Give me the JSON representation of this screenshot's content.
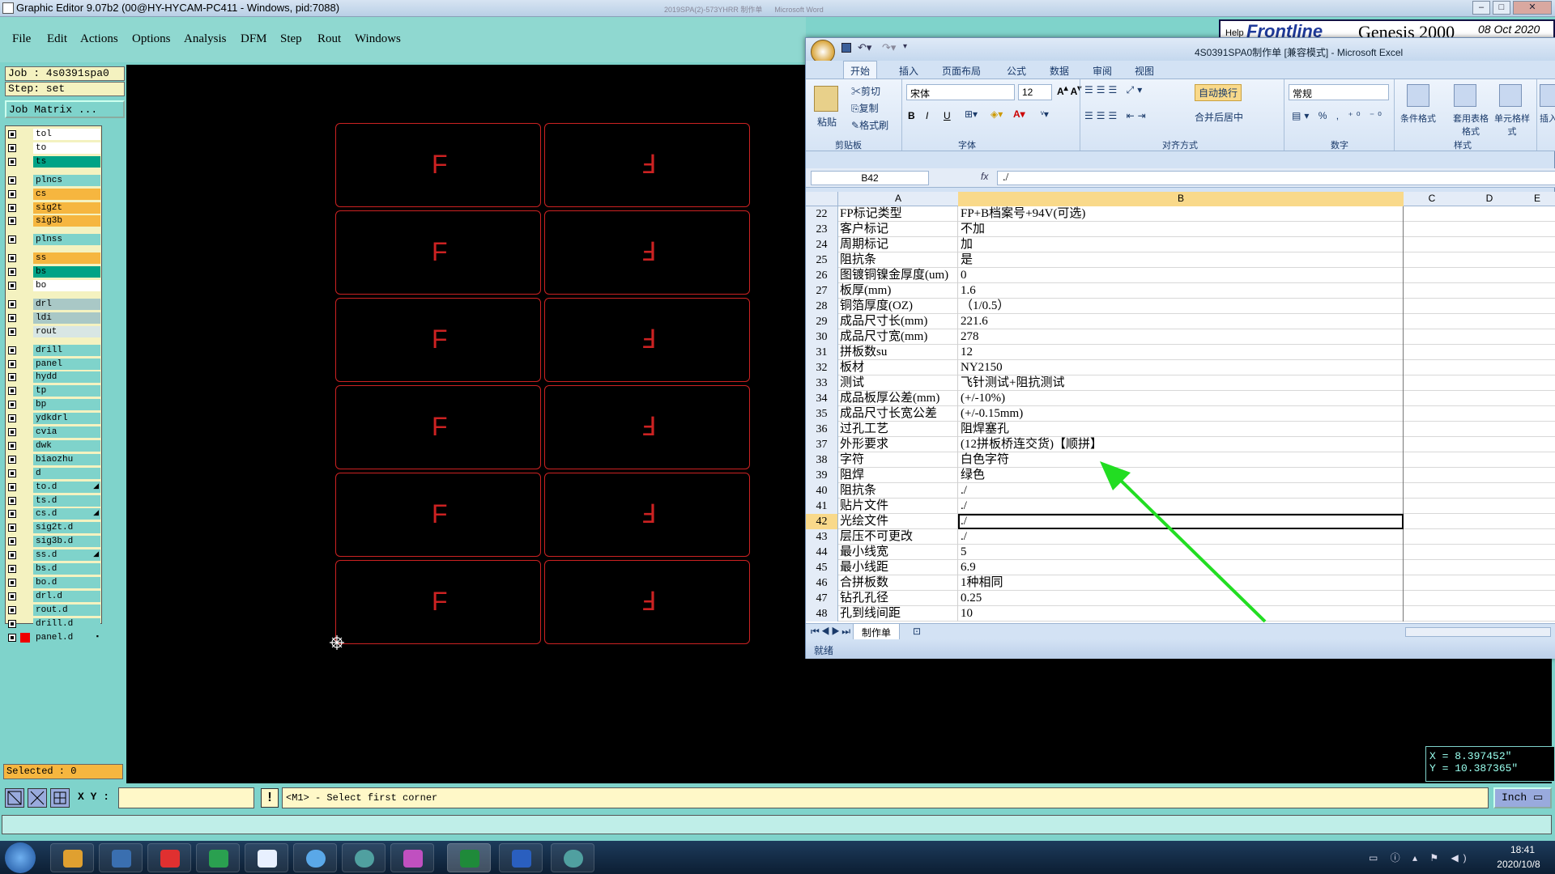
{
  "window": {
    "title": "Graphic Editor 9.07b2 (00@HY-HYCAM-PC411 - Windows, pid:7088)"
  },
  "background_window": {
    "text1": "2019SPA(2)-573YHRR 制作单",
    "text2": "Microsoft Word"
  },
  "genesis_brand": {
    "logo": "Frontline",
    "product": "Genesis 2000",
    "date": "08 Oct 2020",
    "help": "Help"
  },
  "menu": [
    "File",
    "Edit",
    "Actions",
    "Options",
    "Analysis",
    "DFM",
    "Step",
    "Rout",
    "Windows"
  ],
  "job": {
    "job_label": "Job : 4s0391spa0",
    "step_label": "Step: set",
    "matrix_button": "Job Matrix ..."
  },
  "layers": [
    {
      "name": "tol",
      "color": "#ffffff",
      "mark": ""
    },
    {
      "name": "to",
      "color": "#ffffff",
      "mark": ""
    },
    {
      "name": "ts",
      "color": "#00a386",
      "mark": ""
    },
    {
      "name": "plncs",
      "color": "#7fd3cb",
      "mark": ""
    },
    {
      "name": "cs",
      "color": "#f6b63f",
      "mark": ""
    },
    {
      "name": "sig2t",
      "color": "#f6b63f",
      "mark": ""
    },
    {
      "name": "sig3b",
      "color": "#f6b63f",
      "mark": ""
    },
    {
      "name": "plnss",
      "color": "#7fd3cb",
      "mark": ""
    },
    {
      "name": "ss",
      "color": "#f6b63f",
      "mark": ""
    },
    {
      "name": "bs",
      "color": "#00a386",
      "mark": ""
    },
    {
      "name": "bo",
      "color": "#ffffff",
      "mark": ""
    },
    {
      "name": "drl",
      "color": "#a9c8c6",
      "mark": ""
    },
    {
      "name": "ldi",
      "color": "#a9c8c6",
      "mark": ""
    },
    {
      "name": "rout",
      "color": "#d8e6e4",
      "mark": ""
    },
    {
      "name": "drill",
      "color": "#7fd3cb",
      "mark": ""
    },
    {
      "name": "panel",
      "color": "#7fd3cb",
      "mark": ""
    },
    {
      "name": "hydd",
      "color": "#7fd3cb",
      "mark": ""
    },
    {
      "name": "tp",
      "color": "#7fd3cb",
      "mark": ""
    },
    {
      "name": "bp",
      "color": "#7fd3cb",
      "mark": ""
    },
    {
      "name": "ydkdrl",
      "color": "#7fd3cb",
      "mark": ""
    },
    {
      "name": "cvia",
      "color": "#7fd3cb",
      "mark": ""
    },
    {
      "name": "dwk",
      "color": "#7fd3cb",
      "mark": ""
    },
    {
      "name": "biaozhu",
      "color": "#7fd3cb",
      "mark": ""
    },
    {
      "name": "d",
      "color": "#7fd3cb",
      "mark": ""
    },
    {
      "name": "to.d",
      "color": "#7fd3cb",
      "mark": "◢"
    },
    {
      "name": "ts.d",
      "color": "#7fd3cb",
      "mark": ""
    },
    {
      "name": "cs.d",
      "color": "#7fd3cb",
      "mark": "◢"
    },
    {
      "name": "sig2t.d",
      "color": "#7fd3cb",
      "mark": ""
    },
    {
      "name": "sig3b.d",
      "color": "#7fd3cb",
      "mark": ""
    },
    {
      "name": "ss.d",
      "color": "#7fd3cb",
      "mark": "◢"
    },
    {
      "name": "bs.d",
      "color": "#7fd3cb",
      "mark": ""
    },
    {
      "name": "bo.d",
      "color": "#7fd3cb",
      "mark": ""
    },
    {
      "name": "drl.d",
      "color": "#7fd3cb",
      "mark": ""
    },
    {
      "name": "rout.d",
      "color": "#7fd3cb",
      "mark": ""
    },
    {
      "name": "drill.d",
      "color": "#7fd3cb",
      "mark": ""
    },
    {
      "name": "panel.d",
      "color": "#7fd3cb",
      "mark": "▪"
    }
  ],
  "selected": "Selected : 0",
  "bottombar": {
    "xy_label": "X Y :",
    "xy_value": "",
    "message": "<M1> - Select first corner",
    "units": "Inch"
  },
  "coords": {
    "x": "X = 8.397452\"",
    "y": "Y = 10.387365\""
  },
  "canvas": {
    "board_glyph_left": "F",
    "board_glyph_right": "Ⅎ",
    "boards": 12,
    "board_color": "#cc2222"
  },
  "excel": {
    "title": "4S0391SPA0制作单 [兼容模式] - Microsoft Excel",
    "tabs": [
      "开始",
      "插入",
      "页面布局",
      "公式",
      "数据",
      "审阅",
      "视图"
    ],
    "clipboard": {
      "paste": "粘贴",
      "cut": "剪切",
      "copy": "复制",
      "format_painter": "格式刷",
      "group": "剪贴板"
    },
    "font": {
      "name": "宋体",
      "size": "12",
      "group": "字体"
    },
    "alignment": {
      "wrap": "自动换行",
      "merge": "合并后居中",
      "group": "对齐方式"
    },
    "number": {
      "format": "常规",
      "group": "数字"
    },
    "styles": {
      "conditional": "条件格式",
      "table": "套用表格格式",
      "cell": "单元格样式",
      "group": "样式"
    },
    "insert_short": "插入",
    "namebox": "B42",
    "formula": "./",
    "fx": "fx",
    "columns": [
      "A",
      "B",
      "C",
      "D",
      "E"
    ],
    "rows": [
      {
        "n": "22",
        "a": "FP标记类型",
        "b": "FP+B档案号+94V(可选)"
      },
      {
        "n": "23",
        "a": "客户标记",
        "b": "不加"
      },
      {
        "n": "24",
        "a": "周期标记",
        "b": "加"
      },
      {
        "n": "25",
        "a": "阻抗条",
        "b": "是"
      },
      {
        "n": "26",
        "a": "图镀铜镍金厚度(um)",
        "b": "0"
      },
      {
        "n": "27",
        "a": "板厚(mm)",
        "b": "1.6"
      },
      {
        "n": "28",
        "a": "铜箔厚度(OZ)",
        "b": "（1/0.5）"
      },
      {
        "n": "29",
        "a": "成品尺寸长(mm)",
        "b": "221.6"
      },
      {
        "n": "30",
        "a": "成品尺寸宽(mm)",
        "b": "278"
      },
      {
        "n": "31",
        "a": "拼板数su",
        "b": "12"
      },
      {
        "n": "32",
        "a": "板材",
        "b": "NY2150"
      },
      {
        "n": "33",
        "a": "测试",
        "b": "飞针测试+阻抗测试"
      },
      {
        "n": "34",
        "a": "成品板厚公差(mm)",
        "b": "(+/-10%)"
      },
      {
        "n": "35",
        "a": "成品尺寸长宽公差",
        "b": "(+/-0.15mm)"
      },
      {
        "n": "36",
        "a": "过孔工艺",
        "b": "阻焊塞孔"
      },
      {
        "n": "37",
        "a": "外形要求",
        "b": "(12拼板桥连交货)【顺拼】"
      },
      {
        "n": "38",
        "a": "字符",
        "b": "白色字符"
      },
      {
        "n": "39",
        "a": "阻焊",
        "b": "绿色"
      },
      {
        "n": "40",
        "a": "阻抗条",
        "b": "./"
      },
      {
        "n": "41",
        "a": "贴片文件",
        "b": "./"
      },
      {
        "n": "42",
        "a": "光绘文件",
        "b": "./"
      },
      {
        "n": "43",
        "a": "层压不可更改",
        "b": "./"
      },
      {
        "n": "44",
        "a": "最小线宽",
        "b": "5"
      },
      {
        "n": "45",
        "a": "最小线距",
        "b": "6.9"
      },
      {
        "n": "46",
        "a": "合拼板数",
        "b": "1种相同"
      },
      {
        "n": "47",
        "a": "钻孔孔径",
        "b": "0.25"
      },
      {
        "n": "48",
        "a": "孔到线间距",
        "b": "10"
      }
    ],
    "active_row": "42",
    "sheet_tab": "制作单",
    "status": "就绪"
  },
  "taskbar": {
    "time": "18:41",
    "date": "2020/10/8"
  },
  "annotation_arrow_color": "#22dd22"
}
